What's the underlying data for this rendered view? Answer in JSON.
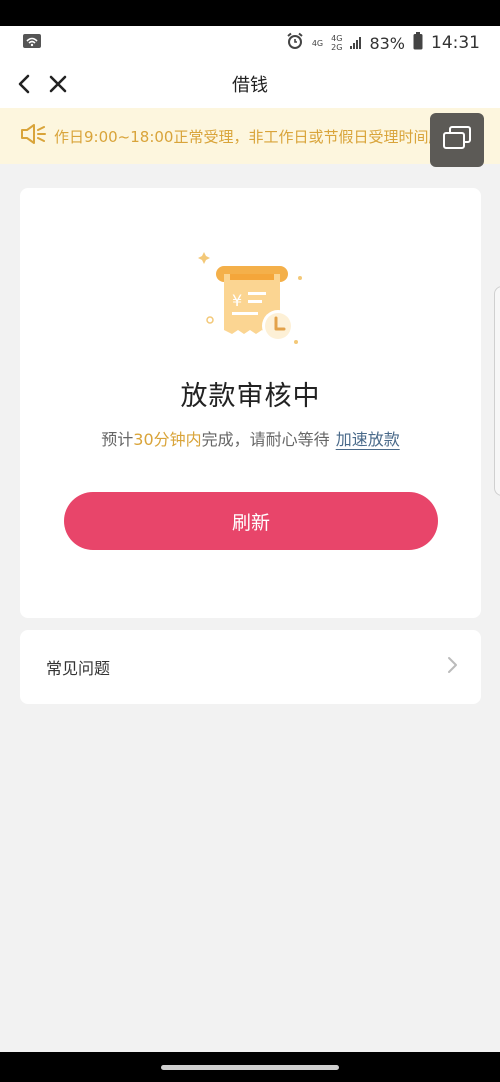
{
  "status_bar": {
    "network_top": "4G",
    "network_bottom": "4G",
    "network_bottom2": "2G",
    "battery": "83%",
    "time": "14:31",
    "icons": [
      "wifi-icon",
      "alarm-icon",
      "signal-icon",
      "battery-icon"
    ]
  },
  "nav": {
    "title": "借钱",
    "back_icon": "chevron-left-icon",
    "close_icon": "close-icon"
  },
  "notice": {
    "text": "作日9:00~18:00正常受理，非工作日或节假日受理时间顺",
    "icon": "speaker-icon"
  },
  "floating": {
    "icon": "window-switch-icon"
  },
  "review": {
    "title": "放款审核中",
    "sub_prefix": "预计",
    "sub_highlight": "30分钟内",
    "sub_suffix": "完成，请耐心等待",
    "speed_link": "加速放款",
    "refresh_label": "刷新",
    "illustration_icon": "receipt-clock-icon"
  },
  "faq": {
    "label": "常见问题",
    "icon": "chevron-right-icon"
  },
  "colors": {
    "accent": "#e8456a",
    "highlight": "#d9a43a",
    "notice_bg": "#fdf6de",
    "link": "#4a6a8a"
  }
}
